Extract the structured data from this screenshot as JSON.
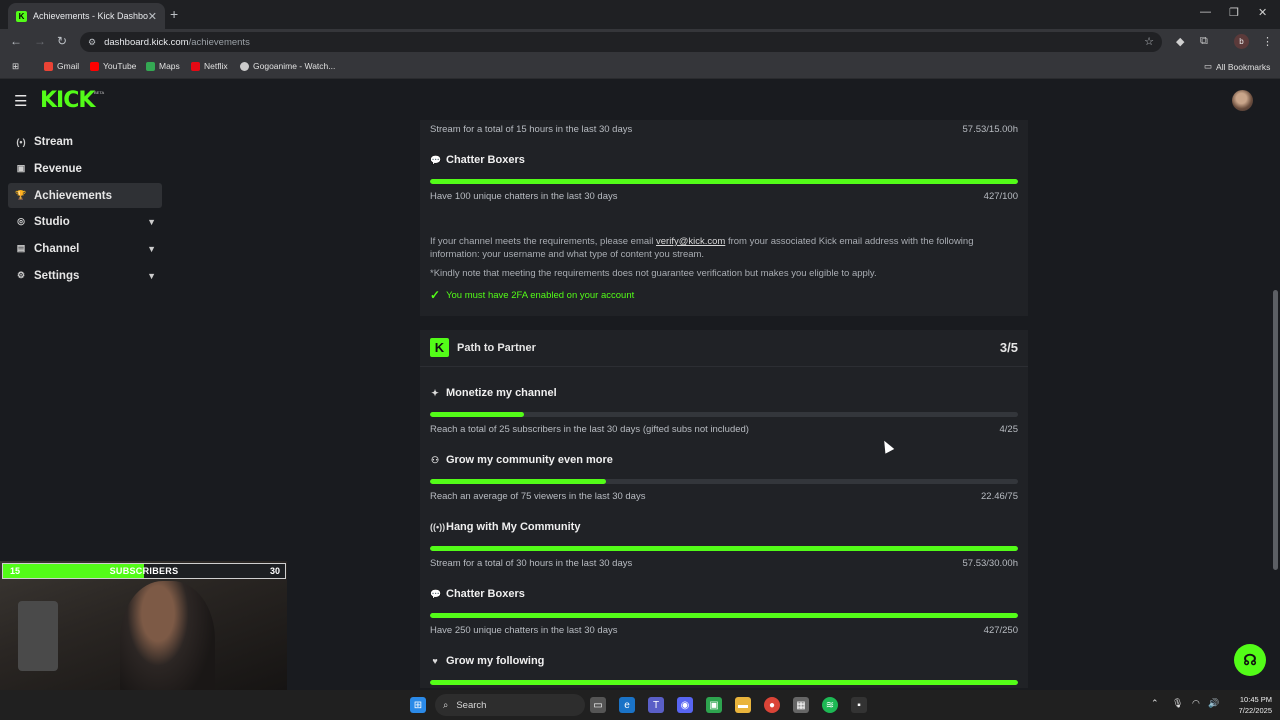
{
  "browser": {
    "tab_title": "Achievements - Kick Dashboard",
    "tab_favicon": "K",
    "url_host": "dashboard.kick.com",
    "url_path": "/achievements",
    "profile_initial": "b",
    "bookmarks": [
      {
        "label": "Gmail",
        "color": "#ea4335"
      },
      {
        "label": "YouTube",
        "color": "#ff0000"
      },
      {
        "label": "Maps",
        "color": "#34a853"
      },
      {
        "label": "Netflix",
        "color": "#e50914"
      },
      {
        "label": "Gogoanime - Watch...",
        "color": "#cccccc"
      }
    ],
    "all_bookmarks": "All Bookmarks"
  },
  "app": {
    "logo": "KICK",
    "logo_badge": "BETA",
    "accent": "#53fc18"
  },
  "sidebar": {
    "items": [
      {
        "label": "Stream",
        "icon": "(•)"
      },
      {
        "label": "Revenue",
        "icon": "▣"
      },
      {
        "label": "Achievements",
        "icon": "🏆"
      },
      {
        "label": "Studio",
        "icon": "◎"
      },
      {
        "label": "Channel",
        "icon": "▤"
      },
      {
        "label": "Settings",
        "icon": "⚙"
      }
    ]
  },
  "verify_card": {
    "top_desc": "Stream for a total of 15 hours in the last 30 days",
    "top_value": "57.53/15.00h",
    "chatter": {
      "title": "Chatter Boxers",
      "desc": "Have 100 unique chatters in the last 30 days",
      "value": "427/100",
      "progress": 1.0
    },
    "info_prefix": "If your channel meets the requirements, please email ",
    "info_email": "verify@kick.com",
    "info_suffix": " from your associated Kick email address with the following information: your username and what type of content you stream.",
    "note": "*Kindly note that meeting the requirements does not guarantee verification but makes you eligible to apply.",
    "twofa": "You must have 2FA enabled on your account"
  },
  "partner_card": {
    "title": "Path to Partner",
    "count": "3/5",
    "rows": [
      {
        "title": "Monetize my channel",
        "icon": "✦",
        "desc": "Reach a total of 25 subscribers in the last 30 days (gifted subs not included)",
        "value": "4/25",
        "progress": 0.16
      },
      {
        "title": "Grow my community even more",
        "icon": "⚇",
        "desc": "Reach an average of 75 viewers in the last 30 days",
        "value": "22.46/75",
        "progress": 0.3
      },
      {
        "title": "Hang with My Community",
        "icon": "((•))",
        "desc": "Stream for a total of 30 hours in the last 30 days",
        "value": "57.53/30.00h",
        "progress": 1.0
      },
      {
        "title": "Chatter Boxers",
        "icon": "💬",
        "desc": "Have 250 unique chatters in the last 30 days",
        "value": "427/250",
        "progress": 1.0
      },
      {
        "title": "Grow my following",
        "icon": "♥",
        "desc": "",
        "value": "",
        "progress": 1.0
      }
    ]
  },
  "overlay": {
    "sub_start": "15",
    "sub_label": "SUBSCRIBERS",
    "sub_end": "30",
    "sub_progress": 0.5
  },
  "taskbar": {
    "search": "Search",
    "time": "10:45 PM",
    "date": "7/22/2025"
  }
}
